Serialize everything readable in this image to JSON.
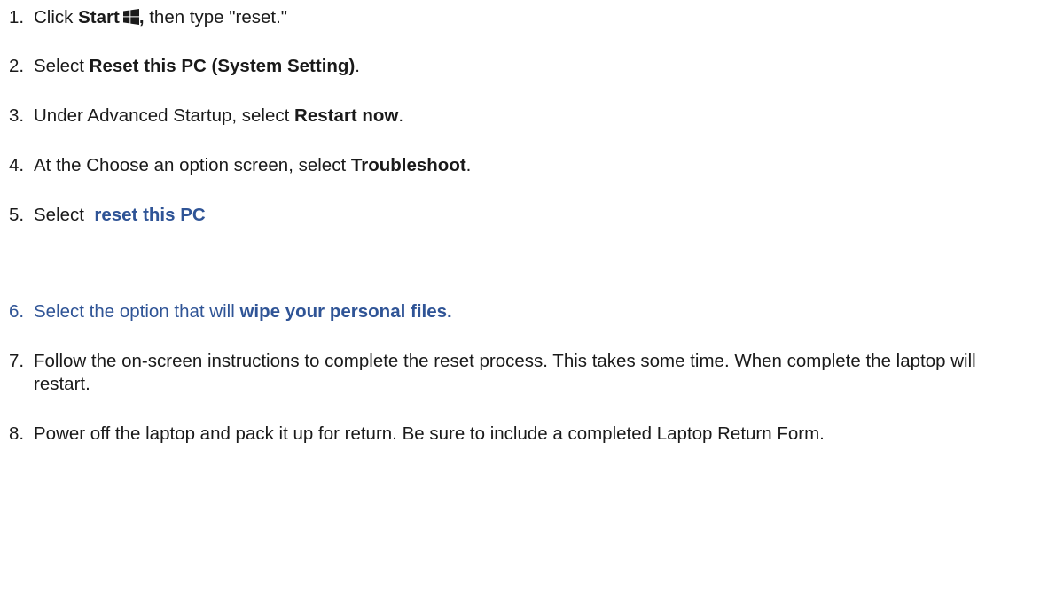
{
  "steps": [
    {
      "number": "1.",
      "pre": "Click ",
      "bold": "Start",
      "icon": "windows-logo-icon",
      "bold2": ",",
      "post": " then type \"reset.\""
    },
    {
      "number": "2.",
      "pre": "Select ",
      "bold": "Reset this PC (System Setting)",
      "post": "."
    },
    {
      "number": "3.",
      "pre": "Under Advanced Startup, select ",
      "bold": "Restart now",
      "post": "."
    },
    {
      "number": "4.",
      "pre": "At the Choose an option screen, select ",
      "bold": "Troubleshoot",
      "post": "."
    },
    {
      "number": "5.",
      "pre": "Select  ",
      "bold": "reset this PC"
    },
    {
      "number": "6.",
      "pre": "Select the option that will ",
      "bold": "wipe your personal files."
    },
    {
      "number": "7.",
      "text": "Follow the on-screen instructions to complete the reset process. This takes some time.  When complete the laptop will restart."
    },
    {
      "number": "8.",
      "text": "Power off the laptop and pack it up for return.  Be sure to include a completed Laptop Return Form."
    }
  ],
  "colors": {
    "text": "#1a1a1a",
    "link_blue": "#2f5496"
  }
}
